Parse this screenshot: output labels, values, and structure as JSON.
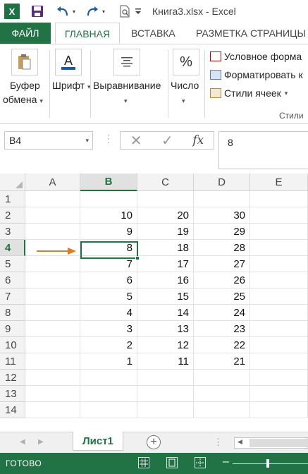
{
  "titlebar": {
    "title": "Книга3.xlsx - Excel",
    "app_logo": "X",
    "icons": [
      "excel-logo-icon",
      "save-icon",
      "undo-icon",
      "redo-icon",
      "print-preview-icon",
      "customize-qat-icon"
    ]
  },
  "tabs": {
    "file": "ФАЙЛ",
    "home": "ГЛАВНАЯ",
    "insert": "ВСТАВКА",
    "layout": "РАЗМЕТКА СТРАНИЦЫ"
  },
  "ribbon": {
    "clipboard_line1": "Буфер",
    "clipboard_line2": "обмена",
    "font": "Шрифт",
    "alignment": "Выравнивание",
    "number": "Число",
    "number_symbol": "%",
    "font_glyph": "A",
    "cond_format": "Условное форма",
    "format_table": "Форматировать к",
    "cell_styles": "Стили ячеек",
    "styles_group": "Стили"
  },
  "formula_bar": {
    "name_box": "B4",
    "formula": "8",
    "fx": "fx",
    "cancel": "✕",
    "enter": "✓"
  },
  "grid": {
    "columns": [
      "A",
      "B",
      "C",
      "D",
      "E"
    ],
    "selected_column": "B",
    "selected_row": "4",
    "rows": [
      {
        "n": "1",
        "b": "",
        "c": "",
        "d": ""
      },
      {
        "n": "2",
        "b": "10",
        "c": "20",
        "d": "30"
      },
      {
        "n": "3",
        "b": "9",
        "c": "19",
        "d": "29"
      },
      {
        "n": "4",
        "b": "8",
        "c": "18",
        "d": "28"
      },
      {
        "n": "5",
        "b": "7",
        "c": "17",
        "d": "27"
      },
      {
        "n": "6",
        "b": "6",
        "c": "16",
        "d": "26"
      },
      {
        "n": "7",
        "b": "5",
        "c": "15",
        "d": "25"
      },
      {
        "n": "8",
        "b": "4",
        "c": "14",
        "d": "24"
      },
      {
        "n": "9",
        "b": "3",
        "c": "13",
        "d": "23"
      },
      {
        "n": "10",
        "b": "2",
        "c": "12",
        "d": "22"
      },
      {
        "n": "11",
        "b": "1",
        "c": "11",
        "d": "21"
      },
      {
        "n": "12",
        "b": "",
        "c": "",
        "d": ""
      },
      {
        "n": "13",
        "b": "",
        "c": "",
        "d": ""
      },
      {
        "n": "14",
        "b": "",
        "c": "",
        "d": ""
      }
    ],
    "annotation_arrow_color": "#e07b1f"
  },
  "sheets": {
    "active": "Лист1",
    "add": "+"
  },
  "status": {
    "text": "ГОТОВО"
  },
  "colors": {
    "accent": "#217346"
  }
}
